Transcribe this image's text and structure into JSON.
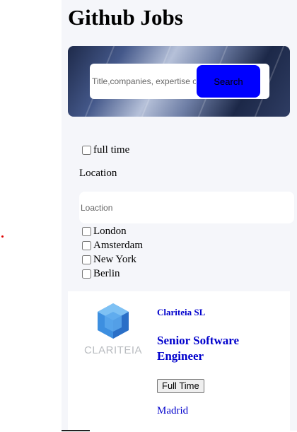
{
  "app": {
    "title": "Github Jobs"
  },
  "search": {
    "placeholder": "Title,companies, expertise or benefits",
    "button_label": "Search"
  },
  "filters": {
    "full_time_label": "full time",
    "location_label": "Location",
    "location_placeholder": "Loaction",
    "cities": [
      "London",
      "Amsterdam",
      "New York",
      "Berlin"
    ]
  },
  "job": {
    "company": "Clariteia SL",
    "logo_text": "CLARITEIA",
    "title": "Senior Software Engineer",
    "type": "Full Time",
    "location": "Madrid"
  },
  "colors": {
    "accent": "#0000ff",
    "link": "#0000cc",
    "panel_bg": "#f5f6fa",
    "logo_blue": "#3d8fe0"
  },
  "icons": [
    "clariteia-logo-icon"
  ]
}
